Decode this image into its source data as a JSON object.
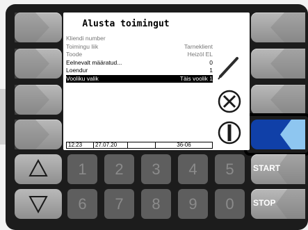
{
  "screen": {
    "title": "Alusta toimingut",
    "rows": [
      {
        "label": "Kliendi number",
        "value": "",
        "style": "muted"
      },
      {
        "label": "Toimingu liik",
        "value": "Tarneklient",
        "style": "muted"
      },
      {
        "label": "Toode",
        "value": "Heizöl EL",
        "style": "muted"
      },
      {
        "label": "Eelnevalt määratud...",
        "value": "0",
        "style": "dark"
      },
      {
        "label": "Loendur",
        "value": "1",
        "style": "dark"
      },
      {
        "label": "Vooliku valik",
        "value": "Täis voolik 1",
        "style": "selected"
      }
    ],
    "status": {
      "time": "12:23",
      "date": "27.07.20",
      "empty": "",
      "code": "36-06"
    }
  },
  "icons": {
    "edit": "pencil-icon",
    "cancel": "cancel-icon",
    "confirm": "confirm-icon"
  },
  "keypad": {
    "row1": [
      "1",
      "2",
      "3",
      "4",
      "5"
    ],
    "row2": [
      "6",
      "7",
      "8",
      "9",
      "0"
    ]
  },
  "buttons": {
    "start": "START",
    "stop": "STOP"
  },
  "colors": {
    "active_key": "#1040a8",
    "active_key_light": "#8ec6f0",
    "screen": "#ffffff"
  }
}
